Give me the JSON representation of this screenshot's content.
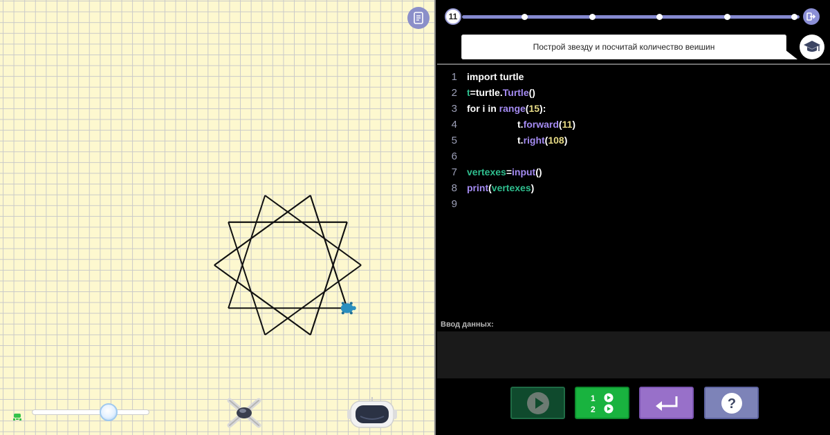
{
  "canvas": {
    "turtle_program": {
      "steps": 15,
      "forward": 11,
      "right_angle": 108
    },
    "speed": 0.65,
    "colors": {
      "background": "#fdf8cf",
      "grid": "#c9c9c9",
      "line": "#111111",
      "turtle": "#2a8fbf"
    }
  },
  "progress": {
    "level": "11",
    "dot_count": 6
  },
  "task": {
    "text": "Построй звезду и посчитай количество веишин"
  },
  "code": {
    "lines": [
      {
        "n": "1",
        "indent": 0,
        "tokens": [
          {
            "t": "import turtle",
            "c": ""
          }
        ]
      },
      {
        "n": "2",
        "indent": 0,
        "tokens": [
          {
            "t": "t",
            "c": "c-teal"
          },
          {
            "t": "=turtle.",
            "c": ""
          },
          {
            "t": "Turtle",
            "c": "c-purple"
          },
          {
            "t": "()",
            "c": ""
          }
        ]
      },
      {
        "n": "3",
        "indent": 0,
        "tokens": [
          {
            "t": "for i in ",
            "c": ""
          },
          {
            "t": "range",
            "c": "c-purple"
          },
          {
            "t": "(",
            "c": ""
          },
          {
            "t": "15",
            "c": "c-num"
          },
          {
            "t": "):",
            "c": ""
          }
        ]
      },
      {
        "n": "4",
        "indent": 1,
        "tokens": [
          {
            "t": "t.",
            "c": ""
          },
          {
            "t": "forward",
            "c": "c-purple"
          },
          {
            "t": "(",
            "c": ""
          },
          {
            "t": "11",
            "c": "c-num"
          },
          {
            "t": ")",
            "c": ""
          }
        ]
      },
      {
        "n": "5",
        "indent": 1,
        "tokens": [
          {
            "t": "t.",
            "c": ""
          },
          {
            "t": "right",
            "c": "c-purple"
          },
          {
            "t": "(",
            "c": ""
          },
          {
            "t": "108",
            "c": "c-num"
          },
          {
            "t": ")",
            "c": ""
          }
        ]
      },
      {
        "n": "6",
        "indent": 0,
        "tokens": []
      },
      {
        "n": "7",
        "indent": 0,
        "tokens": [
          {
            "t": "vertexes",
            "c": "c-teal"
          },
          {
            "t": "=",
            "c": ""
          },
          {
            "t": "input",
            "c": "c-purple"
          },
          {
            "t": "()",
            "c": ""
          }
        ]
      },
      {
        "n": "8",
        "indent": 0,
        "tokens": [
          {
            "t": "print",
            "c": "c-purple"
          },
          {
            "t": "(",
            "c": ""
          },
          {
            "t": "vertexes",
            "c": "c-teal"
          },
          {
            "t": ")",
            "c": ""
          }
        ]
      },
      {
        "n": "9",
        "indent": 0,
        "tokens": []
      }
    ]
  },
  "input": {
    "label": "Ввод данных:",
    "value": ""
  },
  "toolbar": {
    "step_labels": [
      "1",
      "2"
    ]
  }
}
